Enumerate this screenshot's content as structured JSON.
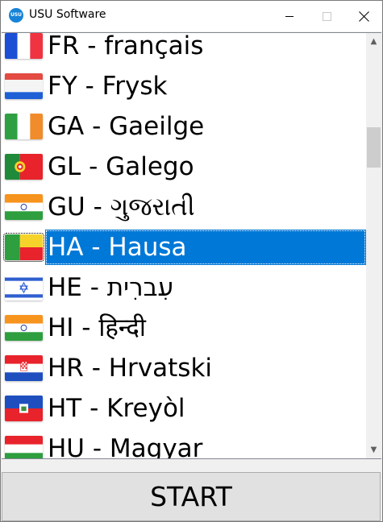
{
  "window": {
    "title": "USU Software",
    "app_icon_text": "USU"
  },
  "languages": [
    {
      "label": "FR - français",
      "flag": "france-flag-icon",
      "selected": false
    },
    {
      "label": "FY - Frysk",
      "flag": "friesland-flag-icon",
      "selected": false
    },
    {
      "label": "GA - Gaeilge",
      "flag": "ireland-flag-icon",
      "selected": false
    },
    {
      "label": "GL - Galego",
      "flag": "portugal-flag-icon",
      "selected": false
    },
    {
      "label": "GU - ગુજરાતી",
      "flag": "india-flag-icon",
      "selected": false
    },
    {
      "label": "HA - Hausa",
      "flag": "benin-flag-icon",
      "selected": true
    },
    {
      "label": "HE - עִברִית",
      "flag": "israel-flag-icon",
      "selected": false
    },
    {
      "label": "HI - हिन्दी",
      "flag": "india-flag-icon",
      "selected": false
    },
    {
      "label": "HR - Hrvatski",
      "flag": "croatia-flag-icon",
      "selected": false
    },
    {
      "label": "HT - Kreyòl",
      "flag": "haiti-flag-icon",
      "selected": false
    },
    {
      "label": "HU - Magyar",
      "flag": "hungary-flag-icon",
      "selected": false
    }
  ],
  "colors": {
    "selection": "#0078d7",
    "titlebar": "#ffffff",
    "button_face": "#e1e1e1"
  },
  "start_button": {
    "label": "START"
  }
}
